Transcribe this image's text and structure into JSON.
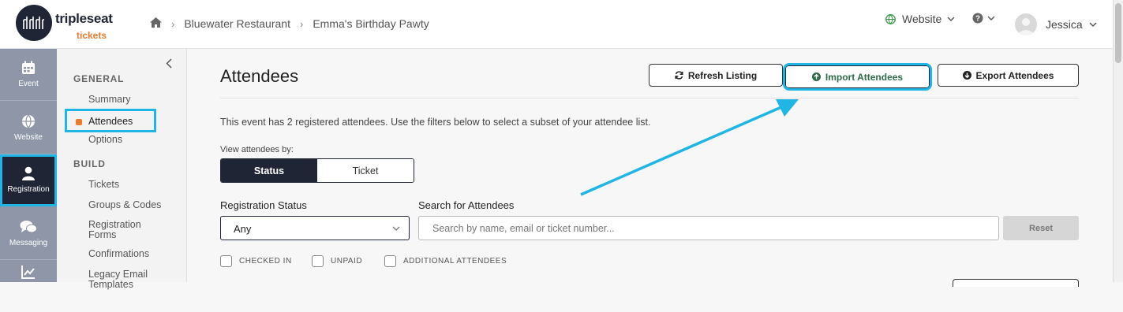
{
  "brand": {
    "name": "tripleseat",
    "sub": "tickets",
    "accent": "#ee7b2c",
    "dark": "#1f2535",
    "highlight": "#1fb6e6"
  },
  "breadcrumb": {
    "home_icon": "home-icon",
    "items": [
      "Bluewater Restaurant",
      "Emma's Birthday Pawty"
    ]
  },
  "topnav": {
    "website_label": "Website",
    "user_name": "Jessica"
  },
  "rail": [
    {
      "label": "Event",
      "icon": "calendar-icon"
    },
    {
      "label": "Website",
      "icon": "globe-icon"
    },
    {
      "label": "Registration",
      "icon": "person-icon"
    },
    {
      "label": "Messaging",
      "icon": "chat-icon"
    }
  ],
  "subnav": {
    "general_heading": "GENERAL",
    "general_items": [
      "Summary",
      "Attendees",
      "Options"
    ],
    "build_heading": "BUILD",
    "build_items": [
      "Tickets",
      "Groups & Codes",
      "Registration Forms",
      "Confirmations",
      "Legacy Email Templates"
    ]
  },
  "main": {
    "title": "Attendees",
    "refresh_label": "Refresh Listing",
    "import_label": "Import Attendees",
    "export_label": "Export Attendees",
    "info": "This event has 2 registered attendees. Use the filters below to select a subset of your attendee list.",
    "view_by_label": "View attendees by:",
    "view_status": "Status",
    "view_ticket": "Ticket",
    "status_label": "Registration Status",
    "status_value": "Any",
    "search_label": "Search for Attendees",
    "search_placeholder": "Search by name, email or ticket number...",
    "reset_label": "Reset",
    "checkboxes": [
      "CHECKED IN",
      "UNPAID",
      "ADDITIONAL ATTENDEES"
    ]
  }
}
